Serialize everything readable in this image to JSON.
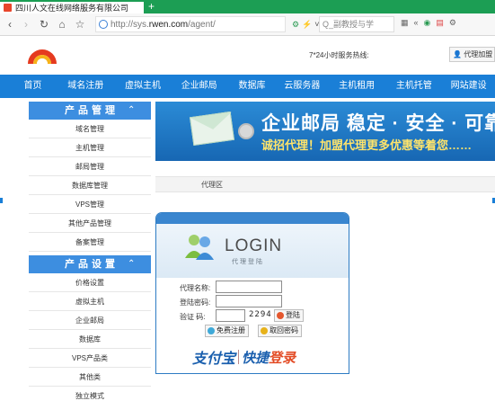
{
  "browser": {
    "tab_title": "四川人文在线网络服务有限公司",
    "new_tab_label": "+",
    "url_prefix": "http://sys.",
    "url_domain": "rwen.com",
    "url_path": "/agent/",
    "search_hint": "Q_副教授与学",
    "ab_icons": [
      "shield-icon",
      "bolt-icon",
      "dropdown-icon"
    ],
    "right_icons": [
      "grid-icon",
      "chevron-icon",
      "shield-check-icon",
      "translate-icon",
      "puzzle-icon"
    ]
  },
  "header": {
    "hotline_label": "7*24小时服务热线:",
    "agent_login_label": "代理加盟"
  },
  "nav": {
    "items": [
      "首页",
      "域名注册",
      "虚拟主机",
      "企业邮局",
      "数据库",
      "云服务器",
      "主机租用",
      "主机托管",
      "网站建设"
    ]
  },
  "sidebar": {
    "product_title": "产品管理",
    "product_items": [
      "域名管理",
      "主机管理",
      "邮局管理",
      "数据库管理",
      "VPS管理",
      "其他产品管理",
      "备案管理"
    ],
    "settings_title": "产品设置",
    "settings_items": [
      "价格设置",
      "虚拟主机",
      "企业邮局",
      "数据库",
      "VPS产品类",
      "其他类",
      "独立模式"
    ]
  },
  "banner": {
    "headline": "企业邮局  稳定 · 安全 · 可靠",
    "subline": "诚招代理！加盟代理更多优惠等着您……"
  },
  "breadcrumb": {
    "label": "代理区"
  },
  "login": {
    "logo_text": "LOGIN",
    "logo_sub": "代理登陆",
    "username_label": "代理名称:",
    "password_label": "登陆密码:",
    "captcha_label": "验证  码:",
    "captcha_value": "2294",
    "login_button": "登陆",
    "register_button": "免费注册",
    "retrieve_button": "取回密码",
    "alipay_logo": "支付宝",
    "quick_login_prefix": "快捷",
    "quick_login_suffix": "登录"
  }
}
